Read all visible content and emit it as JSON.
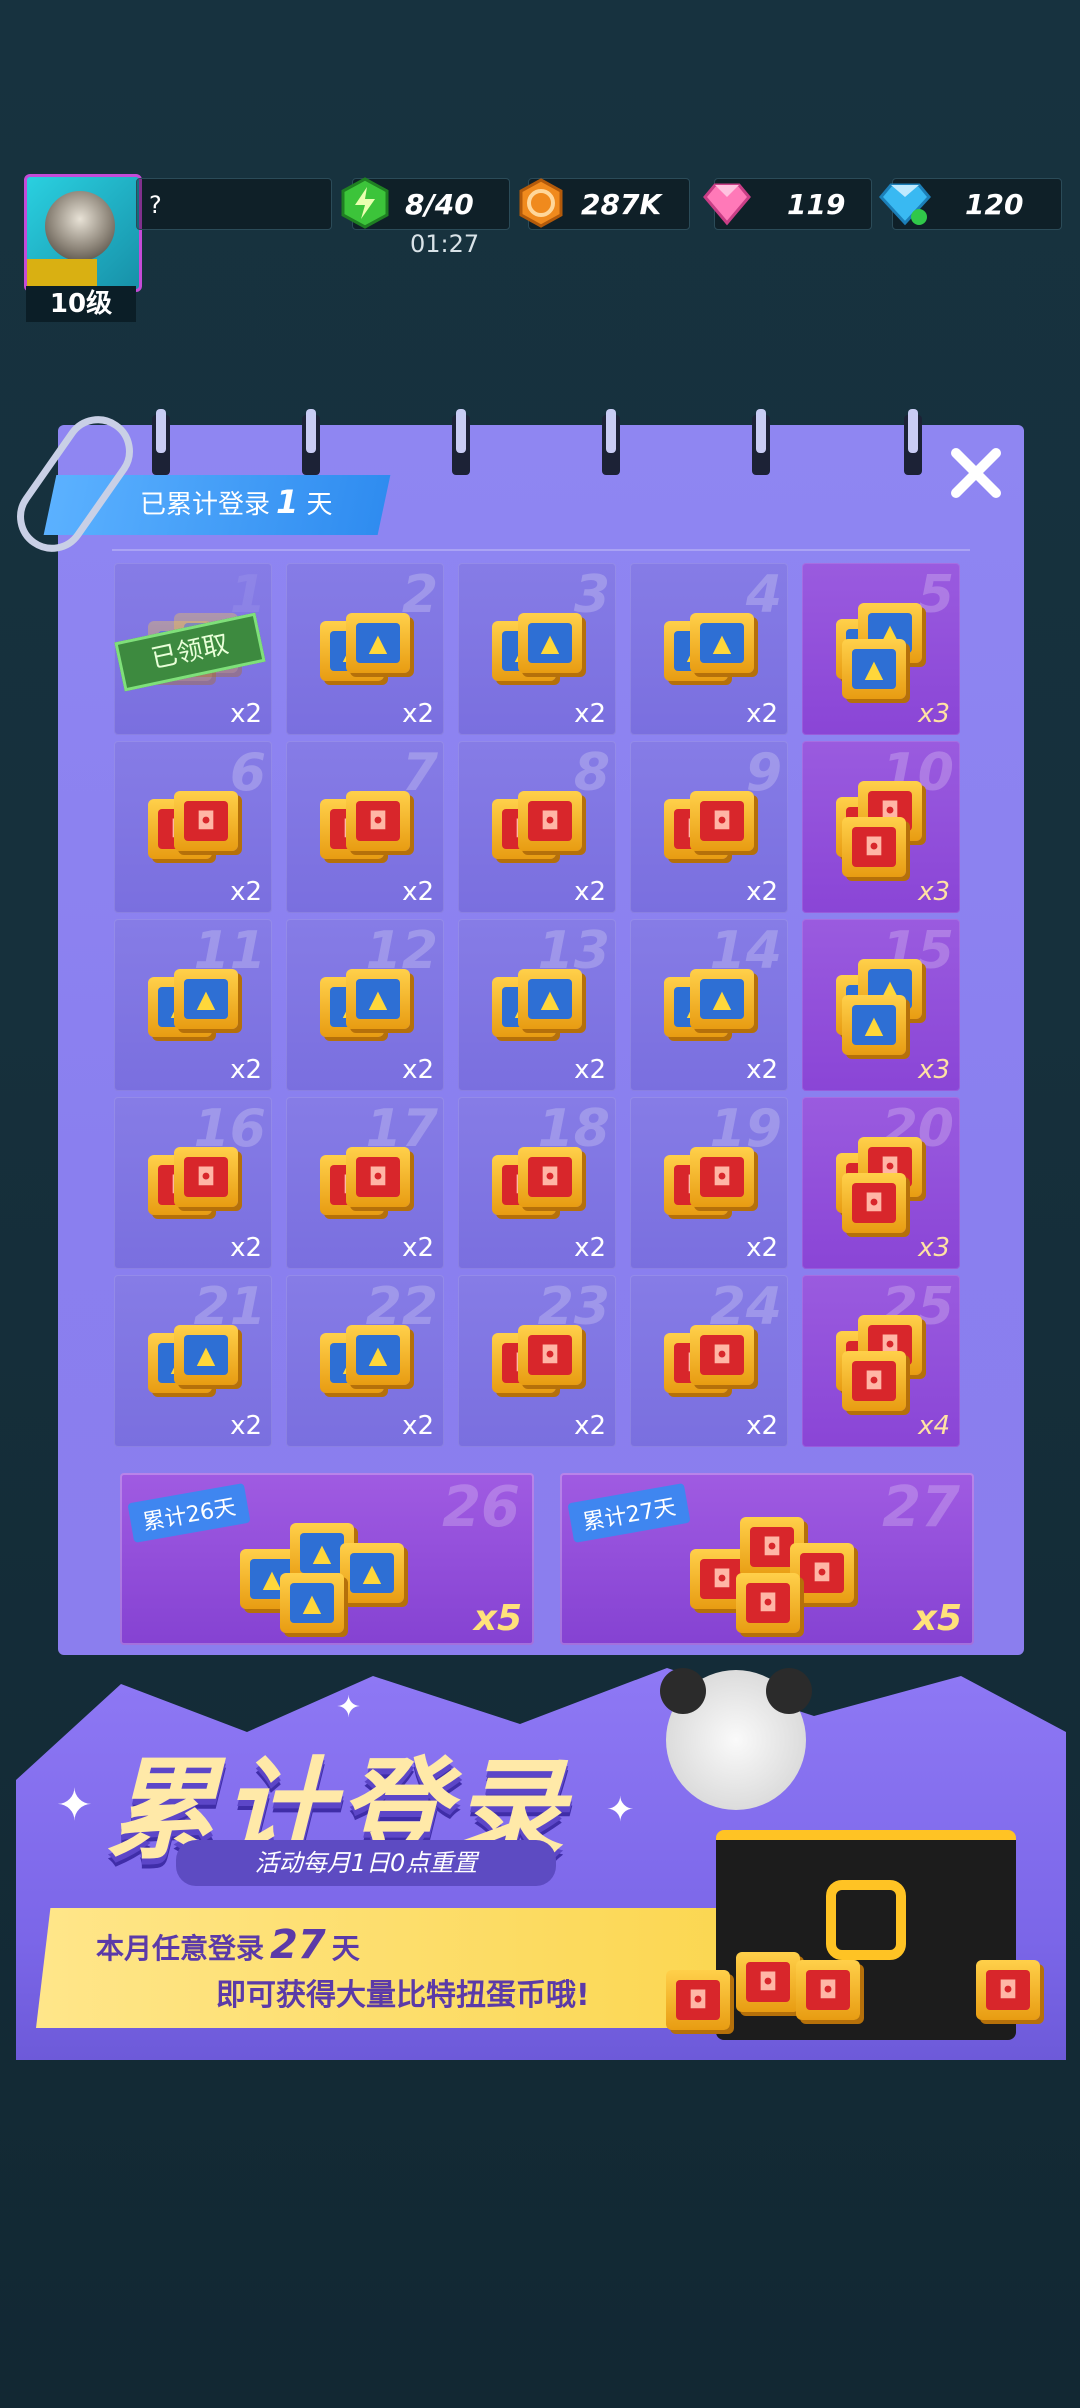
{
  "topbar": {
    "player_name": "?",
    "level": "10级",
    "energy": "8/40",
    "energy_timer": "01:27",
    "coins": "287K",
    "pink_gems": "119",
    "blue_diamonds": "120"
  },
  "panel": {
    "banner_prefix": "已累计登录",
    "banner_days": "1",
    "banner_suffix": "天",
    "claimed_label": "已领取",
    "days": [
      {
        "day": "1",
        "qty": "x2",
        "icon": "blue-capsule",
        "claimed": true
      },
      {
        "day": "2",
        "qty": "x2",
        "icon": "blue-capsule"
      },
      {
        "day": "3",
        "qty": "x2",
        "icon": "blue-capsule"
      },
      {
        "day": "4",
        "qty": "x2",
        "icon": "blue-capsule"
      },
      {
        "day": "5",
        "qty": "x3",
        "icon": "blue-capsule",
        "big": true
      },
      {
        "day": "6",
        "qty": "x2",
        "icon": "red-capsule"
      },
      {
        "day": "7",
        "qty": "x2",
        "icon": "red-capsule"
      },
      {
        "day": "8",
        "qty": "x2",
        "icon": "red-capsule"
      },
      {
        "day": "9",
        "qty": "x2",
        "icon": "red-capsule"
      },
      {
        "day": "10",
        "qty": "x3",
        "icon": "red-capsule",
        "big": true
      },
      {
        "day": "11",
        "qty": "x2",
        "icon": "blue-capsule"
      },
      {
        "day": "12",
        "qty": "x2",
        "icon": "blue-capsule"
      },
      {
        "day": "13",
        "qty": "x2",
        "icon": "blue-capsule"
      },
      {
        "day": "14",
        "qty": "x2",
        "icon": "blue-capsule"
      },
      {
        "day": "15",
        "qty": "x3",
        "icon": "blue-capsule",
        "big": true
      },
      {
        "day": "16",
        "qty": "x2",
        "icon": "red-capsule"
      },
      {
        "day": "17",
        "qty": "x2",
        "icon": "red-capsule"
      },
      {
        "day": "18",
        "qty": "x2",
        "icon": "red-capsule"
      },
      {
        "day": "19",
        "qty": "x2",
        "icon": "red-capsule"
      },
      {
        "day": "20",
        "qty": "x3",
        "icon": "red-capsule",
        "big": true
      },
      {
        "day": "21",
        "qty": "x2",
        "icon": "blue-capsule"
      },
      {
        "day": "22",
        "qty": "x2",
        "icon": "blue-capsule"
      },
      {
        "day": "23",
        "qty": "x2",
        "icon": "red-capsule"
      },
      {
        "day": "24",
        "qty": "x2",
        "icon": "red-capsule"
      },
      {
        "day": "25",
        "qty": "x4",
        "icon": "red-capsule",
        "big": true
      }
    ],
    "special": [
      {
        "day": "26",
        "tag": "累计26天",
        "qty": "x5",
        "icon": "blue-capsule"
      },
      {
        "day": "27",
        "tag": "累计27天",
        "qty": "x5",
        "icon": "red-capsule"
      }
    ]
  },
  "promo": {
    "headline": "累计登录",
    "reset_note": "活动每月1日0点重置",
    "line1_prefix": "本月任意登录",
    "line1_days": "27",
    "line1_suffix": "天",
    "line2": "即可获得大量比特扭蛋币哦!"
  },
  "colors": {
    "panel": "#8a7fef",
    "highlight_cell": "#8a45d6",
    "banner": "#3f96f5",
    "headline": "#ffe9a8"
  }
}
